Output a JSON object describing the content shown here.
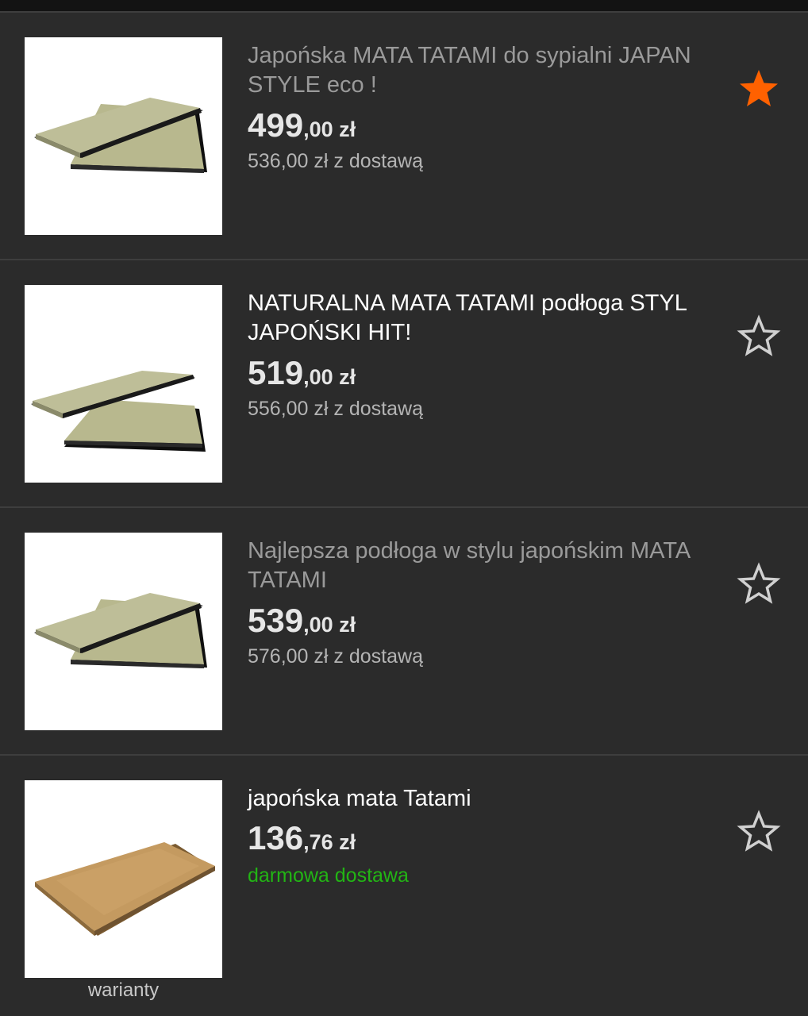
{
  "items": [
    {
      "title": "Japońska MATA TATAMI do sypialni JAPAN STYLE eco !",
      "visited": true,
      "price_main": "499",
      "price_dec": ",00 zł",
      "shipping": "536,00 zł z dostawą",
      "favorited": true,
      "image": "tatami-mats-image"
    },
    {
      "title": "NATURALNA MATA TATAMI podłoga STYL JAPOŃSKI HIT!",
      "visited": false,
      "price_main": "519",
      "price_dec": ",00 zł",
      "shipping": "556,00 zł z dostawą",
      "favorited": false,
      "image": "tatami-mats-image"
    },
    {
      "title": "Najlepsza podłoga w stylu japońskim MATA TATAMI",
      "visited": true,
      "price_main": "539",
      "price_dec": ",00 zł",
      "shipping": "576,00 zł z dostawą",
      "favorited": false,
      "image": "tatami-mats-image"
    },
    {
      "title": "japońska mata Tatami",
      "visited": false,
      "price_main": "136",
      "price_dec": ",76 zł",
      "shipping": "darmowa dostawa",
      "free_shipping": true,
      "favorited": false,
      "image": "flat-mat-image",
      "variants_label": "warianty"
    }
  ],
  "colors": {
    "background": "#2b2b2b",
    "star_active": "#ff6100",
    "star_outline": "#d0d0d0",
    "free_shipping": "#22b514"
  }
}
